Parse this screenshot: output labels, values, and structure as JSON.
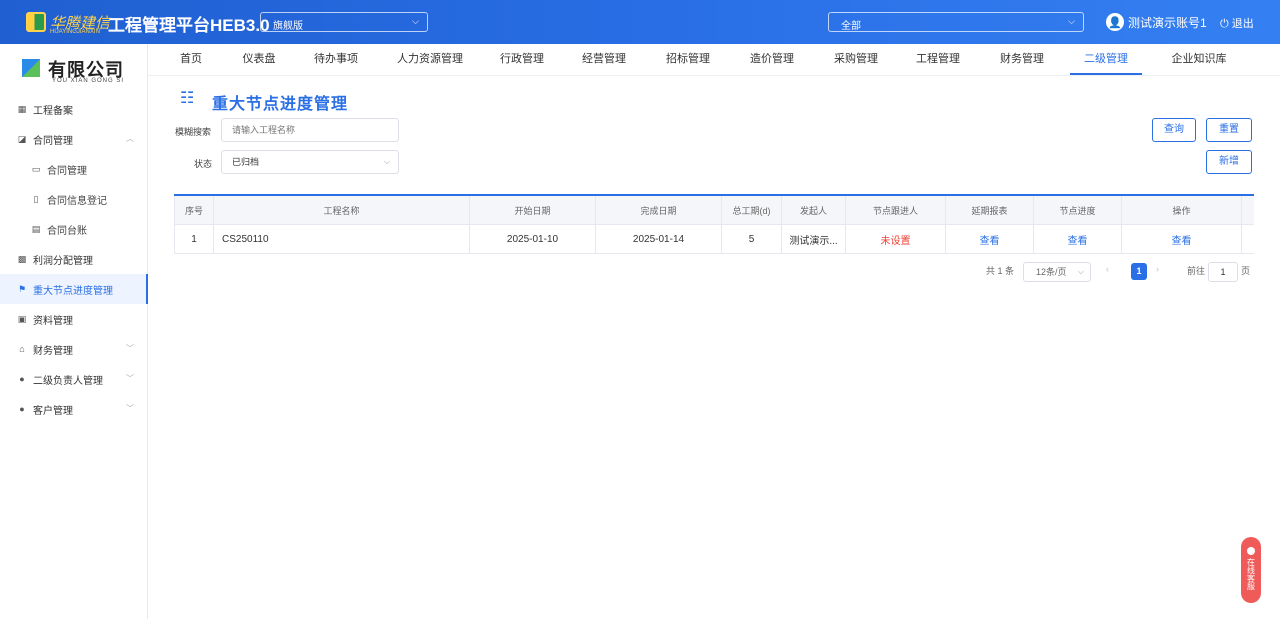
{
  "header": {
    "logo_text": "华腾建信",
    "logo_sub": "HUAYINGJIANXIN",
    "app_title": "工程管理平台HEB3.0",
    "edition": "旗舰版",
    "scope": "全部",
    "user_name": "测试演示账号1",
    "logout_label": "退出"
  },
  "sidebar": {
    "company_name": "有限公司",
    "company_sub": "YOU XIAN GONG SI",
    "items": [
      {
        "label": "工程备案",
        "icon": "grid-icon"
      },
      {
        "label": "合同管理",
        "icon": "handshake-icon"
      },
      {
        "label": "合同管理",
        "icon": "briefcase-icon"
      },
      {
        "label": "合同信息登记",
        "icon": "document-icon"
      },
      {
        "label": "合同台账",
        "icon": "ledger-icon"
      },
      {
        "label": "利润分配管理",
        "icon": "chart-icon"
      },
      {
        "label": "重大节点进度管理",
        "icon": "flag-icon"
      },
      {
        "label": "资料管理",
        "icon": "folder-icon"
      },
      {
        "label": "财务管理",
        "icon": "bank-icon"
      },
      {
        "label": "二级负责人管理",
        "icon": "person-icon"
      },
      {
        "label": "客户管理",
        "icon": "person-icon"
      }
    ]
  },
  "nav": {
    "tabs": [
      "首页",
      "仪表盘",
      "待办事项",
      "人力资源管理",
      "行政管理",
      "经营管理",
      "招标管理",
      "造价管理",
      "采购管理",
      "工程管理",
      "财务管理",
      "二级管理",
      "企业知识库"
    ],
    "active": "二级管理"
  },
  "page": {
    "title": "重大节点进度管理",
    "search_label": "模糊搜索",
    "search_placeholder": "请输入工程名称",
    "status_label": "状态",
    "status_value": "已归档",
    "query_button": "查询",
    "reset_button": "重置",
    "add_button": "新增"
  },
  "table": {
    "headers": [
      "序号",
      "工程名称",
      "开始日期",
      "完成日期",
      "总工期(d)",
      "发起人",
      "节点跟进人",
      "延期报表",
      "节点进度",
      "操作"
    ],
    "rows": [
      [
        "1",
        "CS250110",
        "2025-01-10",
        "2025-01-14",
        "5",
        "测试演示...",
        "未设置",
        "查看",
        "查看",
        "查看"
      ]
    ]
  },
  "pagination": {
    "total": "共 1 条",
    "page_size": "12条/页",
    "current_page": "1",
    "goto_label": "前往",
    "goto_value": "1",
    "page_suffix": "页"
  },
  "support": {
    "label": "在线客服"
  },
  "colors": {
    "primary": "#2a6fe6",
    "danger": "#f04134",
    "support": "#ef5b58"
  }
}
